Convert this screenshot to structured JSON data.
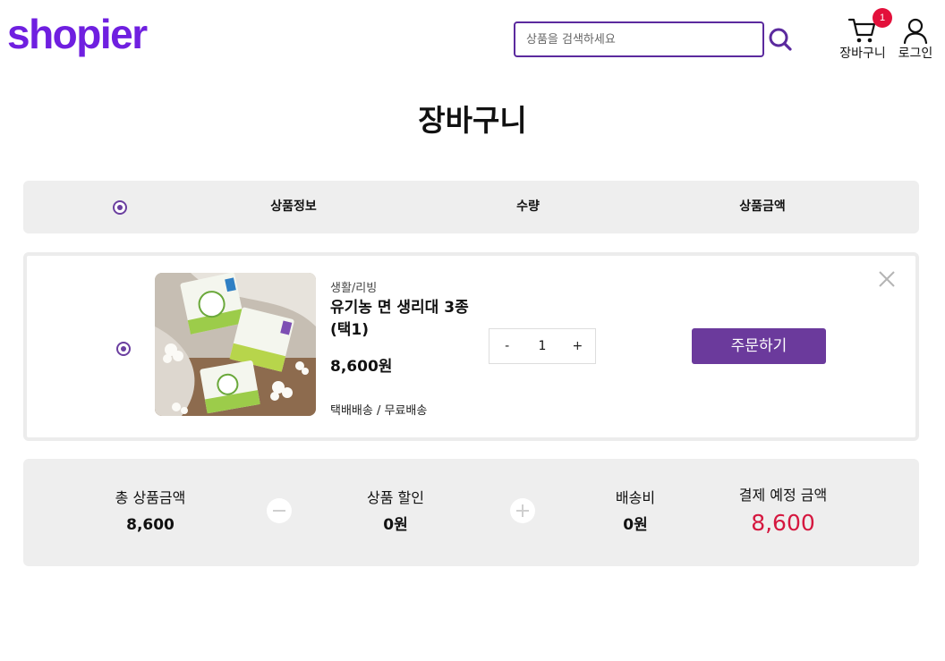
{
  "header": {
    "logo": "shopier",
    "search": {
      "placeholder": "상품을 검색하세요",
      "value": ""
    },
    "cart_label": "장바구니",
    "cart_count": "1",
    "login_label": "로그인"
  },
  "page_title": "장바구니",
  "table_header": {
    "product_info": "상품정보",
    "quantity": "수량",
    "price": "상품금액"
  },
  "items": [
    {
      "category": "생활/리빙",
      "name": "유기농 면 생리대 3종 (택1)",
      "price": "8,600원",
      "shipping": "택배배송 / 무료배송",
      "quantity": "1",
      "qty_minus": "-",
      "qty_plus": "+",
      "order_button": "주문하기",
      "selected": true
    }
  ],
  "summary": {
    "total_label": "총 상품금액",
    "total_value": "8,600",
    "discount_label": "상품 할인",
    "discount_value": "0원",
    "shipping_label": "배송비",
    "shipping_value": "0원",
    "final_label": "결제 예정 금액",
    "final_value": "8,600"
  },
  "colors": {
    "brand": "#6f1fe0",
    "accent": "#6b3a9c",
    "badge": "#e3103b",
    "final_price": "#d5173f",
    "panel_bg": "#eeeeee"
  }
}
